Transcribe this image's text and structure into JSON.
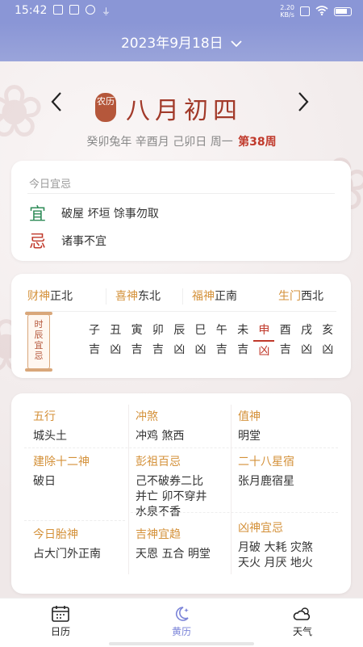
{
  "status_bar": {
    "time": "15:42",
    "net_speed": "2.20\nKB/s",
    "battery_icon": "battery-icon",
    "wifi_icon": "wifi-icon"
  },
  "header": {
    "date": "2023年9月18日",
    "dropdown_icon": "chevron-down-icon"
  },
  "lunar": {
    "seal": "农历",
    "date": "八月初四",
    "prev_icon": "chevron-left-icon",
    "next_icon": "chevron-right-icon",
    "ganzhi": "癸卯兔年 辛酉月 己卯日 周一",
    "week": "第38周"
  },
  "today_yiji": {
    "title": "今日宜忌",
    "yi_mark": "宜",
    "yi": "破屋 坏垣 馀事勿取",
    "ji_mark": "忌",
    "ji": "诸事不宜"
  },
  "gods": [
    {
      "label": "财神",
      "value": "正北"
    },
    {
      "label": "喜神",
      "value": "东北"
    },
    {
      "label": "福神",
      "value": "正南"
    },
    {
      "label": "生门",
      "value": "西北"
    }
  ],
  "shichen": {
    "label": "时辰宜忌",
    "hours": [
      {
        "zhi": "子",
        "luck": "吉"
      },
      {
        "zhi": "丑",
        "luck": "凶"
      },
      {
        "zhi": "寅",
        "luck": "吉"
      },
      {
        "zhi": "卯",
        "luck": "吉"
      },
      {
        "zhi": "辰",
        "luck": "凶"
      },
      {
        "zhi": "巳",
        "luck": "凶"
      },
      {
        "zhi": "午",
        "luck": "吉"
      },
      {
        "zhi": "未",
        "luck": "吉"
      },
      {
        "zhi": "申",
        "luck": "凶"
      },
      {
        "zhi": "酉",
        "luck": "吉"
      },
      {
        "zhi": "戌",
        "luck": "凶"
      },
      {
        "zhi": "亥",
        "luck": "凶"
      }
    ],
    "current_index": 8
  },
  "details": {
    "wuxing": {
      "label": "五行",
      "value": "城头土"
    },
    "chongsha": {
      "label": "冲煞",
      "value": "冲鸡 煞西"
    },
    "zhishen": {
      "label": "值神",
      "value": "明堂"
    },
    "jianchu": {
      "label": "建除十二神",
      "value": "破日"
    },
    "pengzu": {
      "label": "彭祖百忌",
      "value": "己不破券二比\n并亡 卯不穿井\n水泉不香"
    },
    "xingxiu": {
      "label": "二十八星宿",
      "value": "张月鹿宿星"
    },
    "taishen": {
      "label": "今日胎神",
      "value": "占大门外正南"
    },
    "jishen": {
      "label": "吉神宜趋",
      "value": "天恩 五合 明堂"
    },
    "xiongshen": {
      "label": "凶神宜忌",
      "value": "月破 大耗 灾煞\n天火 月厌 地火"
    }
  },
  "tabbar": {
    "tabs": [
      {
        "label": "日历",
        "icon": "calendar-icon"
      },
      {
        "label": "黄历",
        "icon": "moon-star-icon"
      },
      {
        "label": "天气",
        "icon": "cloud-sun-icon"
      }
    ],
    "active_index": 1
  },
  "colors": {
    "header": "#8a96d6",
    "accent_red": "#c0392b",
    "label_orange": "#d4913a",
    "yi_green": "#2e8b57",
    "active_tab": "#7b84d8"
  }
}
